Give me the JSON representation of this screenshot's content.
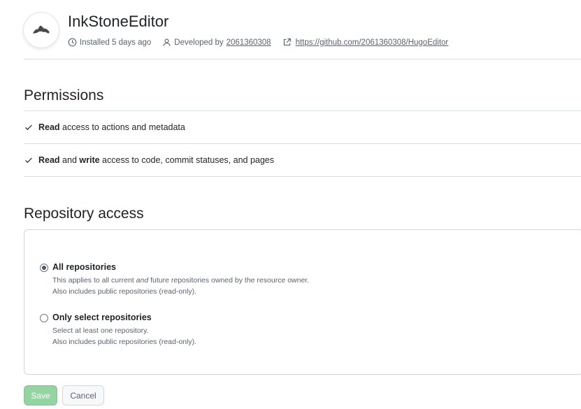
{
  "app": {
    "name": "InkStoneEditor",
    "installed": "Installed 5 days ago",
    "developed_prefix": "Developed by",
    "developer": "2061360308",
    "url": "https://github.com/2061360308/HugoEditor"
  },
  "permissions": {
    "title": "Permissions",
    "items": [
      {
        "a1": "Read",
        "t1": " access to actions and metadata",
        "a2": "",
        "t2": ""
      },
      {
        "a1": "Read",
        "t1": " and ",
        "a2": "write",
        "t2": " access to code, commit statuses, and pages"
      }
    ]
  },
  "repository_access": {
    "title": "Repository access",
    "options": [
      {
        "label": "All repositories",
        "selected": true,
        "desc1_pre": "This applies to all current ",
        "desc1_em": "and",
        "desc1_post": " future repositories owned by the resource owner.",
        "desc2": "Also includes public repositories (read-only)."
      },
      {
        "label": "Only select repositories",
        "selected": false,
        "desc1_pre": "Select at least one repository.",
        "desc1_em": "",
        "desc1_post": "",
        "desc2": "Also includes public repositories (read-only)."
      }
    ]
  },
  "actions": {
    "save": "Save",
    "cancel": "Cancel"
  },
  "colors": {
    "save_bg": "#94d3a2",
    "border": "#d8dee4"
  }
}
